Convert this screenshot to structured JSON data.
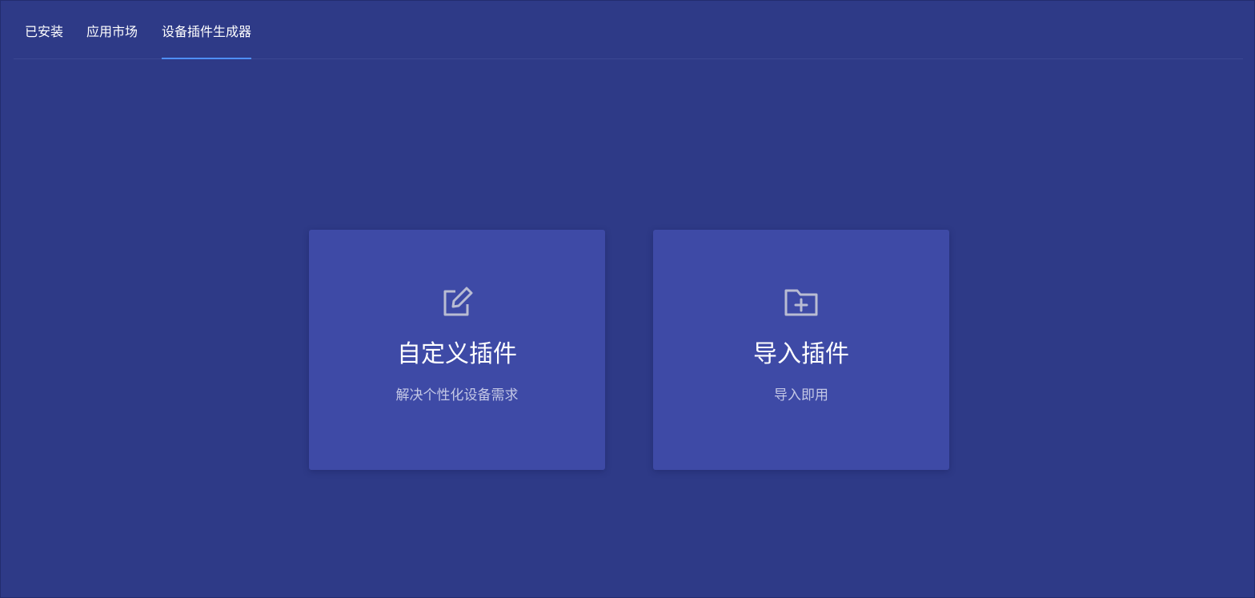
{
  "tabs": [
    {
      "label": "已安装",
      "active": false
    },
    {
      "label": "应用市场",
      "active": false
    },
    {
      "label": "设备插件生成器",
      "active": true
    }
  ],
  "cards": [
    {
      "icon": "edit-icon",
      "title": "自定义插件",
      "description": "解决个性化设备需求"
    },
    {
      "icon": "folder-add-icon",
      "title": "导入插件",
      "description": "导入即用"
    }
  ],
  "colors": {
    "background": "#2e3a87",
    "card": "#3e4aa6",
    "active_tab_indicator": "#4f8ff7",
    "icon": "#b9bcd3",
    "text_primary": "#ffffff",
    "text_secondary": "#c4c8e6"
  }
}
